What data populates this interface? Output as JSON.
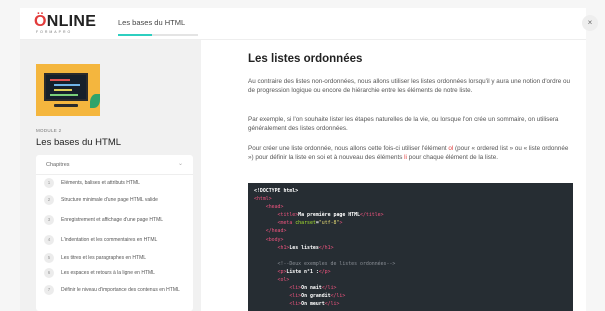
{
  "header": {
    "logo_main_prefix": "Ö",
    "logo_main_rest": "NLINE",
    "logo_sub": "FORMAPRO",
    "course_title": "Les bases du HTML",
    "progress": 0.42,
    "close_label": "×",
    "accent": "#2ecfc0"
  },
  "sidebar": {
    "module_label": "MODULE 2",
    "module_title": "Les bases du HTML",
    "chapters_title": "Chapitres",
    "chapters_chevron": "⌄",
    "chapters": [
      {
        "num": "1",
        "text": "Eléments, balises et attributs HTML"
      },
      {
        "num": "2",
        "text": "Structure minimale d'une page HTML valide"
      },
      {
        "num": "3",
        "text": "Enregistrement et affichage d'une page HTML"
      },
      {
        "num": "4",
        "text": "L'indentation et les commentaires en HTML"
      },
      {
        "num": "5",
        "text": "Les titres et les paragraphes en HTML"
      },
      {
        "num": "6",
        "text": "Les espaces et retours à la ligne en HTML"
      },
      {
        "num": "7",
        "text": "Définir le niveau d'importance des contenus en HTML"
      }
    ]
  },
  "main": {
    "title": "Les listes ordonnées",
    "p1": "Au contraire des listes non-ordonnées, nous allons utiliser les listes ordonnées lorsqu'il y aura une notion d'ordre ou de progression logique ou encore de hiérarchie entre les éléments de notre liste.",
    "p2": "Par exemple, si l'on souhaite lister les étapes naturelles de la vie, ou lorsque l'on crée un sommaire, on utilisera généralement des listes ordonnées.",
    "p3_a": "Pour créer une liste ordonnée, nous allons cette fois-ci utiliser l'élément ",
    "p3_el1": "ol",
    "p3_b": " (pour « ordered list » ou « liste ordonnée ») pour définir la liste en soi et à nouveau des éléments ",
    "p3_el2": "li",
    "p3_c": " pour chaque élément de la liste.",
    "accent_red": "#e03c3c"
  },
  "code": {
    "colors": {
      "tag": "#f0547f",
      "text": "#ffffff",
      "comment": "#8a8f96",
      "attr": "#a6e22e",
      "string": "#e6db74",
      "bg": "#262d33"
    },
    "lines": [
      [
        {
          "t": "<!DOCTYPE html>",
          "c": "text"
        }
      ],
      [
        {
          "t": "<html>",
          "c": "tag"
        }
      ],
      [
        {
          "t": "    <head>",
          "c": "tag"
        }
      ],
      [
        {
          "t": "        <title>",
          "c": "tag"
        },
        {
          "t": "Ma première page HTML",
          "c": "text"
        },
        {
          "t": "</title>",
          "c": "tag"
        }
      ],
      [
        {
          "t": "        <meta ",
          "c": "tag"
        },
        {
          "t": "charset",
          "c": "attr"
        },
        {
          "t": "=",
          "c": "text"
        },
        {
          "t": "\"utf-8\"",
          "c": "string"
        },
        {
          "t": ">",
          "c": "tag"
        }
      ],
      [
        {
          "t": "    </head>",
          "c": "tag"
        }
      ],
      [
        {
          "t": "    <body>",
          "c": "tag"
        }
      ],
      [
        {
          "t": "        <h1>",
          "c": "tag"
        },
        {
          "t": "Les listes",
          "c": "text"
        },
        {
          "t": "</h1>",
          "c": "tag"
        }
      ],
      [
        {
          "t": "",
          "c": "text"
        }
      ],
      [
        {
          "t": "        <!--Deux exemples de listes ordonnées-->",
          "c": "comment"
        }
      ],
      [
        {
          "t": "        <p>",
          "c": "tag"
        },
        {
          "t": "Liste n°1 :",
          "c": "text"
        },
        {
          "t": "</p>",
          "c": "tag"
        }
      ],
      [
        {
          "t": "        <ol>",
          "c": "tag"
        }
      ],
      [
        {
          "t": "            <li>",
          "c": "tag"
        },
        {
          "t": "On nait",
          "c": "text"
        },
        {
          "t": "</li>",
          "c": "tag"
        }
      ],
      [
        {
          "t": "            <li>",
          "c": "tag"
        },
        {
          "t": "On grandit",
          "c": "text"
        },
        {
          "t": "</li>",
          "c": "tag"
        }
      ],
      [
        {
          "t": "            <li>",
          "c": "tag"
        },
        {
          "t": "On meurt",
          "c": "text"
        },
        {
          "t": "</li>",
          "c": "tag"
        }
      ]
    ]
  }
}
